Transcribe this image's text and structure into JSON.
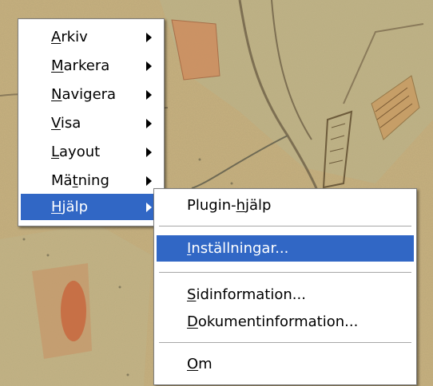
{
  "main_menu": {
    "items": [
      {
        "pre": "",
        "key": "A",
        "post": "rkiv",
        "has_submenu": true
      },
      {
        "pre": "",
        "key": "M",
        "post": "arkera",
        "has_submenu": true
      },
      {
        "pre": "",
        "key": "N",
        "post": "avigera",
        "has_submenu": true
      },
      {
        "pre": "",
        "key": "V",
        "post": "isa",
        "has_submenu": true
      },
      {
        "pre": "",
        "key": "L",
        "post": "ayout",
        "has_submenu": true
      },
      {
        "pre": "Mä",
        "key": "t",
        "post": "ning",
        "has_submenu": true
      },
      {
        "pre": "",
        "key": "H",
        "post": "jälp",
        "has_submenu": true,
        "active": true
      }
    ]
  },
  "help_submenu": {
    "items": [
      {
        "pre": "Plugin-",
        "key": "h",
        "post": "jälp"
      },
      {
        "pre": "",
        "key": "I",
        "post": "nställningar...",
        "active": true
      },
      {
        "pre": "",
        "key": "S",
        "post": "idinformation..."
      },
      {
        "pre": "",
        "key": "D",
        "post": "okumentinformation..."
      },
      {
        "pre": "",
        "key": "O",
        "post": "m"
      }
    ]
  },
  "colors": {
    "highlight": "#3167c5",
    "map_base": "#c9b27f",
    "map_road": "#8a7a5a",
    "map_parcel": "#d07a4a"
  },
  "background_icon": "historic-cadastral-map"
}
